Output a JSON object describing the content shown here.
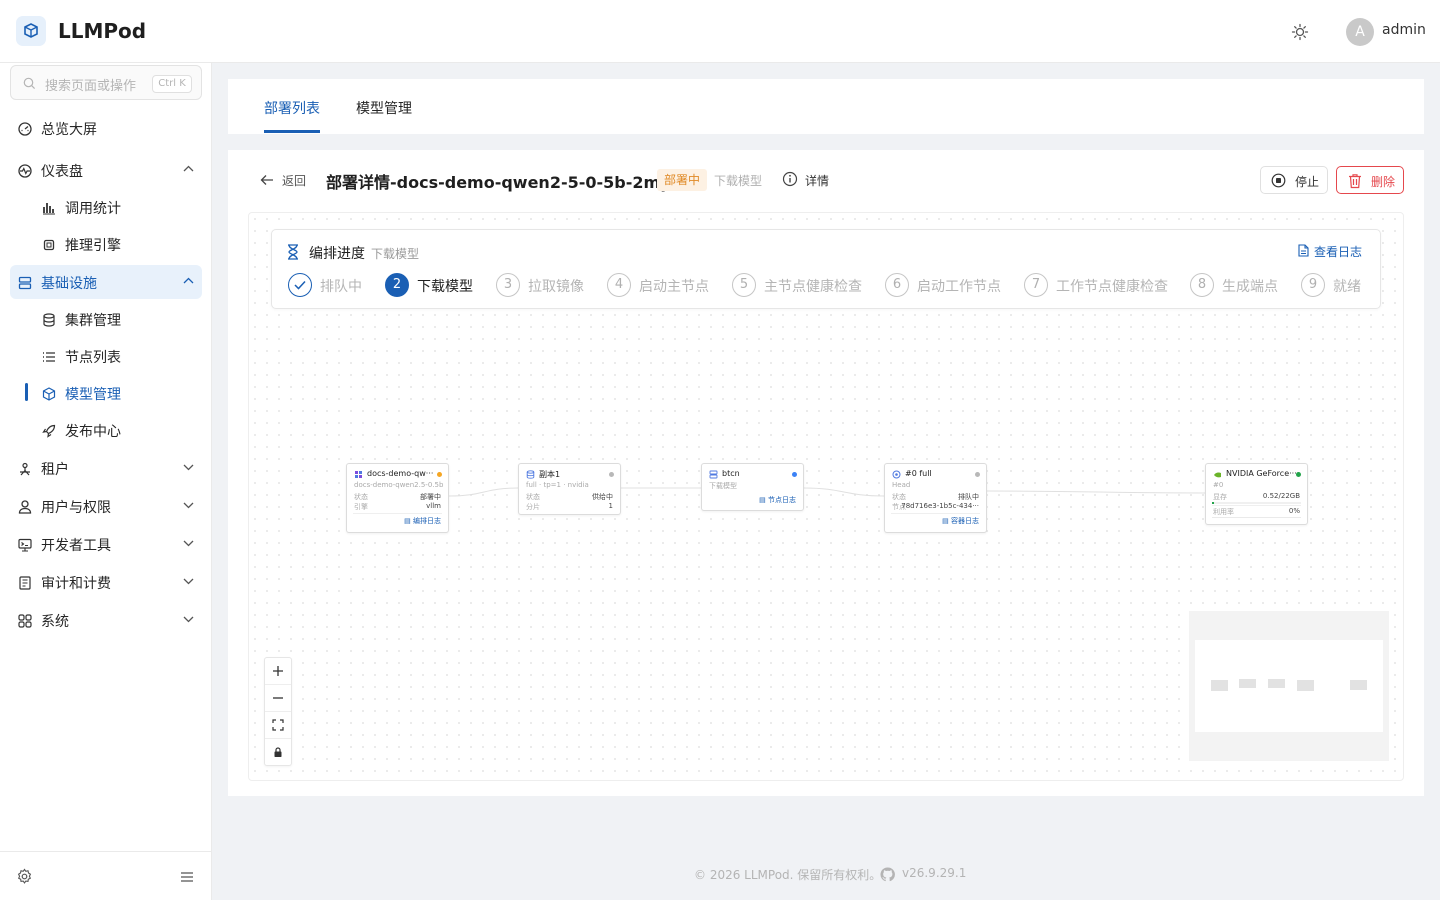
{
  "app": {
    "name": "LLMPod"
  },
  "header": {
    "user_initial": "A",
    "username": "admin"
  },
  "search": {
    "placeholder": "搜索页面或操作",
    "shortcut": "Ctrl K"
  },
  "sidebar": {
    "items": [
      {
        "label": "总览大屏",
        "icon": "dashboard-gauge-icon"
      },
      {
        "label": "仪表盘",
        "icon": "pulse-icon",
        "expanded": true,
        "children": [
          {
            "label": "调用统计",
            "icon": "bar-chart-icon"
          },
          {
            "label": "推理引擎",
            "icon": "cpu-icon"
          }
        ]
      },
      {
        "label": "基础设施",
        "icon": "server-icon",
        "expanded": true,
        "children": [
          {
            "label": "集群管理",
            "icon": "database-icon"
          },
          {
            "label": "节点列表",
            "icon": "list-icon"
          },
          {
            "label": "模型管理",
            "icon": "cube-icon",
            "current": true
          },
          {
            "label": "发布中心",
            "icon": "rocket-icon"
          }
        ]
      },
      {
        "label": "租户",
        "icon": "tenant-icon"
      },
      {
        "label": "用户与权限",
        "icon": "user-icon"
      },
      {
        "label": "开发者工具",
        "icon": "terminal-icon"
      },
      {
        "label": "审计和计费",
        "icon": "receipt-icon"
      },
      {
        "label": "系统",
        "icon": "grid-icon"
      }
    ]
  },
  "tabs": [
    {
      "label": "部署列表",
      "active": true
    },
    {
      "label": "模型管理",
      "active": false
    }
  ],
  "detail": {
    "back_label": "返回",
    "title": "部署详情-docs-demo-qwen2-5-0-5b-2my1",
    "status": "部署中",
    "status_sub": "下载模型",
    "info_label": "详情",
    "stop_label": "停止",
    "delete_label": "删除"
  },
  "progress": {
    "title": "编排进度",
    "current_step_label": "下载模型",
    "view_logs": "查看日志",
    "steps": [
      {
        "num": "1",
        "label": "排队中",
        "state": "done"
      },
      {
        "num": "2",
        "label": "下载模型",
        "state": "current"
      },
      {
        "num": "3",
        "label": "拉取镜像",
        "state": "pending"
      },
      {
        "num": "4",
        "label": "启动主节点",
        "state": "pending"
      },
      {
        "num": "5",
        "label": "主节点健康检查",
        "state": "pending"
      },
      {
        "num": "6",
        "label": "启动工作节点",
        "state": "pending"
      },
      {
        "num": "7",
        "label": "工作节点健康检查",
        "state": "pending"
      },
      {
        "num": "8",
        "label": "生成端点",
        "state": "pending"
      },
      {
        "num": "9",
        "label": "就绪",
        "state": "pending"
      }
    ]
  },
  "flow": {
    "deployment": {
      "title": "docs-demo-qw···",
      "subtitle": "docs-demo-qwen2.5-0.5b",
      "status_label": "状态",
      "status_value": "部署中",
      "engine_label": "引擎",
      "engine_value": "vllm",
      "link": "编排日志",
      "dot_color": "#f5a623"
    },
    "replica": {
      "title": "副本1",
      "subtitle": "full · tp=1 · nvidia",
      "status_label": "状态",
      "status_value": "供给中",
      "shard_label": "分片",
      "shard_value": "1",
      "dot_color": "#b8b8b8"
    },
    "node": {
      "title": "btcn",
      "subtitle": "下载模型",
      "link": "节点日志",
      "dot_color": "#3b82f6"
    },
    "container": {
      "title": "#0 full",
      "subtitle": "Head",
      "status_label": "状态",
      "status_value": "排队中",
      "node_label": "节点",
      "node_value": "78d716e3-1b5c-434···",
      "link": "容器日志",
      "dot_color": "#b8b8b8"
    },
    "gpu": {
      "title": "NVIDIA GeForce···",
      "subtitle": "#0",
      "mem_label": "显存",
      "mem_value": "0.52/22GB",
      "util_label": "利用率",
      "util_value": "0%",
      "mem_fraction": 0.024,
      "dot_color": "#22a34a"
    }
  },
  "footer": {
    "copyright": "© 2026 LLMPod. 保留所有权利。",
    "version": "v26.9.29.1"
  },
  "colors": {
    "accent": "#1a5fb4",
    "danger": "#e5484d",
    "warning": "#e08a27"
  }
}
